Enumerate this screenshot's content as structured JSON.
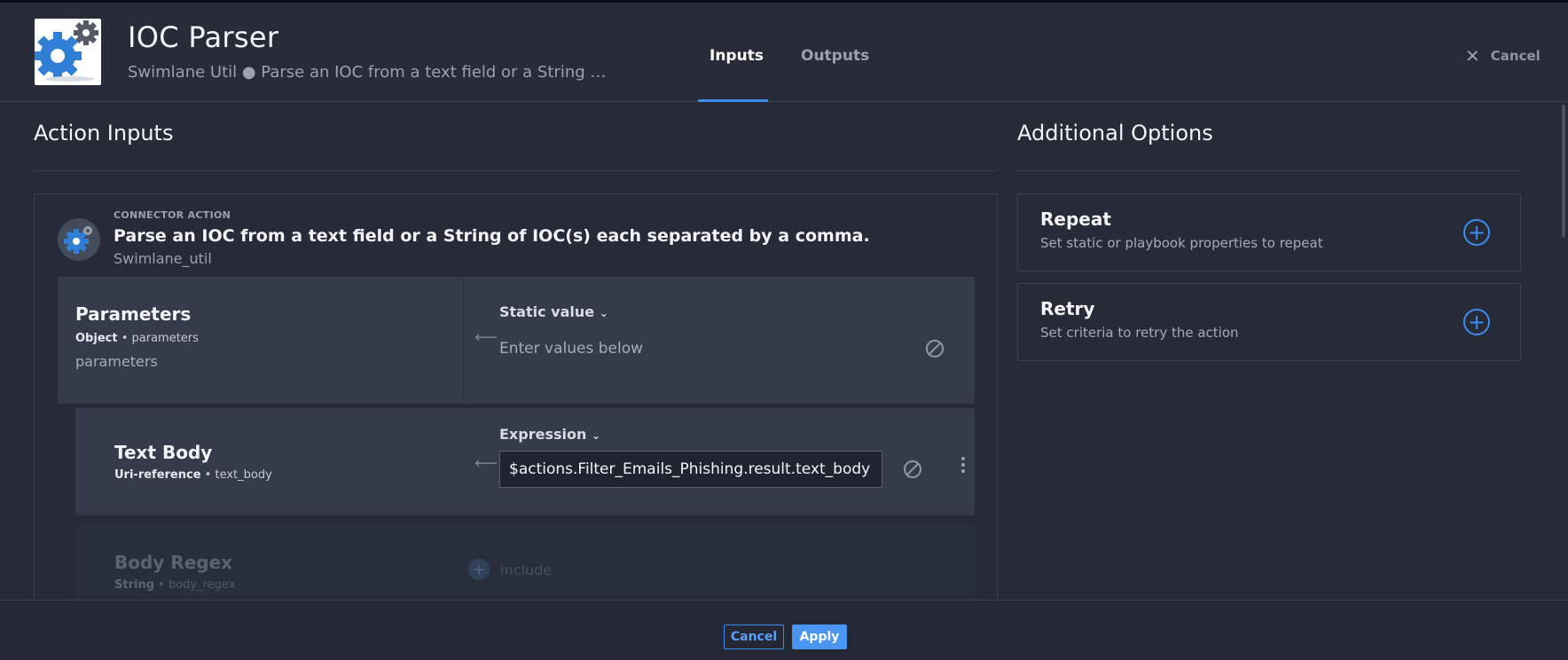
{
  "header": {
    "title": "IOC Parser",
    "subtitle": "Swimlane Util ● Parse an IOC from a text field or a String …",
    "tabs": [
      {
        "label": "Inputs",
        "active": true
      },
      {
        "label": "Outputs",
        "active": false
      }
    ],
    "cancel_label": "Cancel"
  },
  "action_inputs": {
    "title": "Action Inputs",
    "connector": {
      "label": "CONNECTOR ACTION",
      "title": "Parse an IOC from a text field or a String of IOC(s) each separated by a comma.",
      "subtitle": "Swimlane_util"
    },
    "parameters": {
      "name": "Parameters",
      "type": "Object",
      "key": "parameters",
      "description": "parameters",
      "mode": "Static value",
      "placeholder": "Enter values below"
    },
    "text_body": {
      "name": "Text Body",
      "type": "Uri-reference",
      "key": "text_body",
      "mode": "Expression",
      "value": "$actions.Filter_Emails_Phishing.result.text_body"
    },
    "body_regex": {
      "name": "Body Regex",
      "type": "String",
      "key": "body_regex",
      "include_label": "Include"
    }
  },
  "additional_options": {
    "title": "Additional Options",
    "items": [
      {
        "title": "Repeat",
        "description": "Set static or playbook properties to repeat"
      },
      {
        "title": "Retry",
        "description": "Set criteria to retry the action"
      }
    ]
  },
  "footer": {
    "cancel_label": "Cancel",
    "apply_label": "Apply"
  },
  "colors": {
    "accent": "#3d8cf0",
    "background": "#262b37",
    "panel": "#353b4a"
  },
  "icons": [
    "gears-logo-icon",
    "close-icon",
    "chevron-down-icon",
    "arrow-left-icon",
    "nullify-icon",
    "kebab-menu-icon",
    "plus-circle-icon"
  ]
}
